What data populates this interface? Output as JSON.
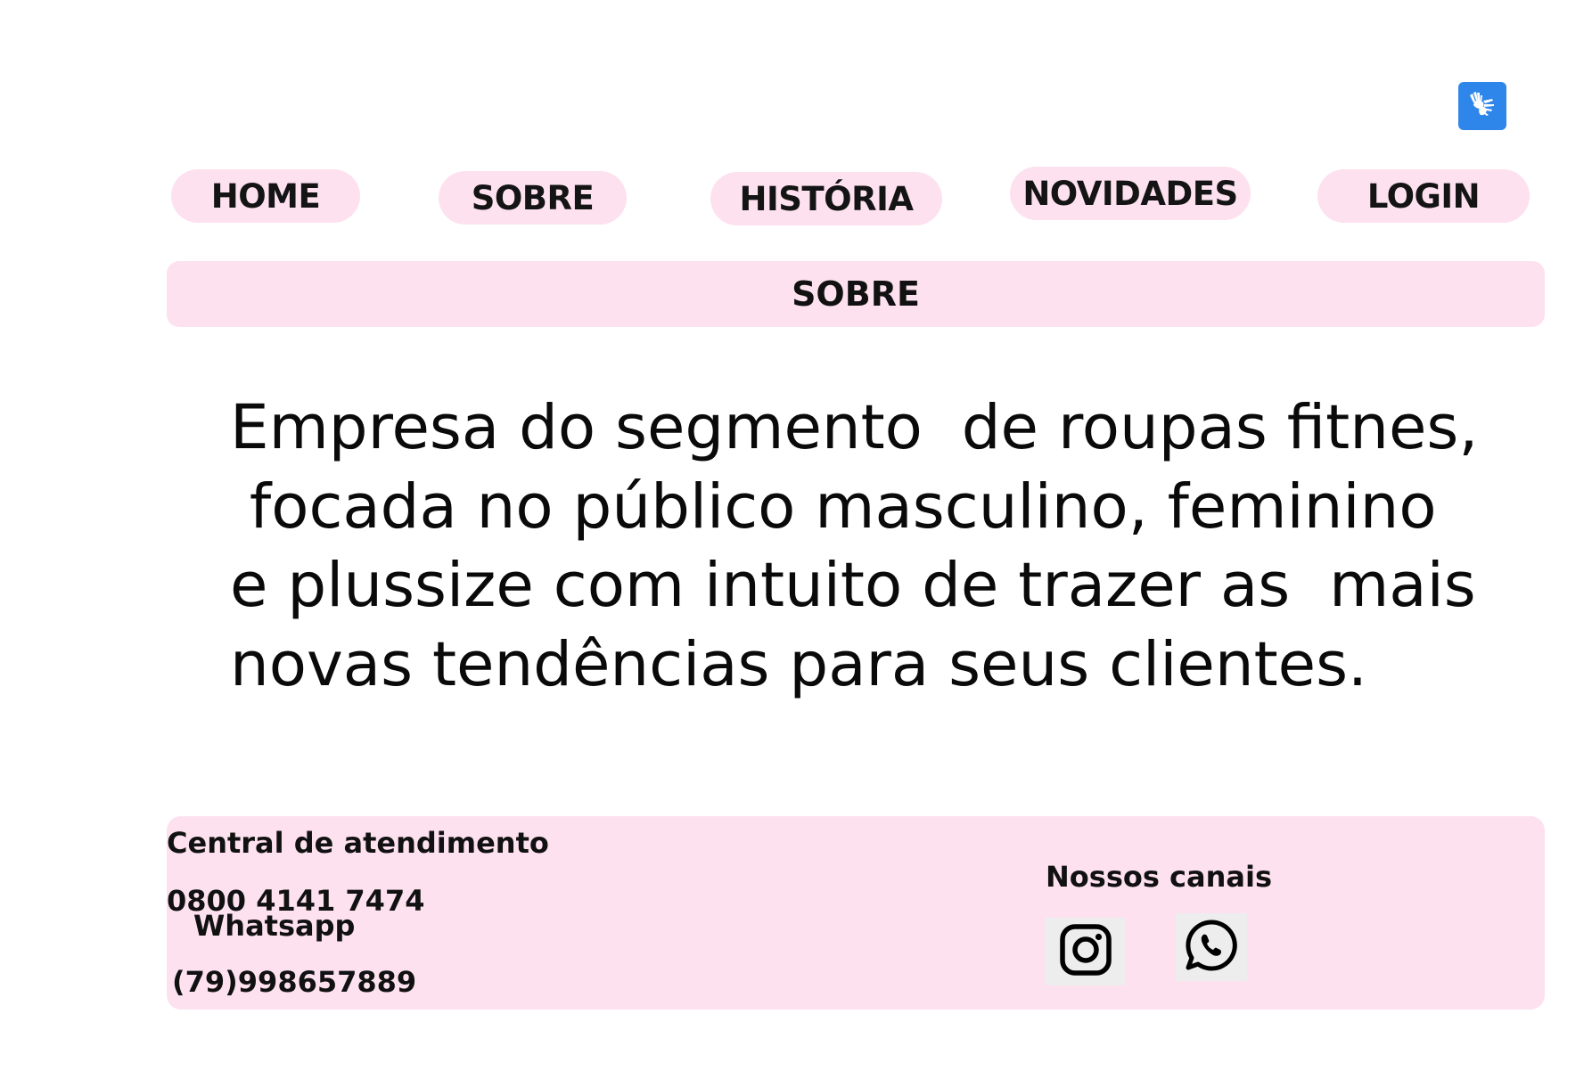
{
  "accessibility": {
    "icon": "sign-language-hands-icon",
    "color": "#2f86ea"
  },
  "nav": {
    "home": "HOME",
    "sobre": "SOBRE",
    "historia": "HISTÓRIA",
    "novidades": "NOVIDADES",
    "login": "LOGIN"
  },
  "section": {
    "title": "SOBRE"
  },
  "about": {
    "line1": "Empresa do segmento  de roupas fitnes,",
    "line2": " focada no público masculino, feminino",
    "line3": "e plussize com intuito de trazer as  mais",
    "line4": "novas tendências para seus clientes."
  },
  "footer": {
    "central_title": "Central de atendimento",
    "central_phone": "0800 4141 7474",
    "whatsapp_label": "Whatsapp",
    "whatsapp_phone": "(79)998657889",
    "channels_title": "Nossos canais",
    "channels": [
      {
        "icon": "instagram-icon"
      },
      {
        "icon": "whatsapp-icon"
      }
    ]
  },
  "colors": {
    "pill_background": "#fde1ef",
    "text": "#111111",
    "accent_blue": "#2f86ea"
  }
}
